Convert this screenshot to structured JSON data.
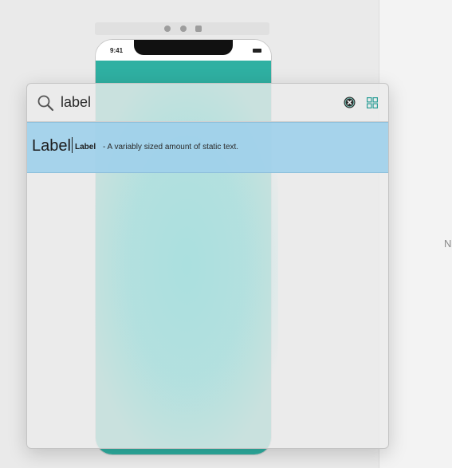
{
  "device": {
    "status_time": "9:41"
  },
  "inspector": {
    "partial_text": "N"
  },
  "library": {
    "search": {
      "value": "label",
      "clear_icon": "clear-circle-icon",
      "view_toggle_icon": "grid-icon"
    },
    "results": [
      {
        "preview_text": "Label",
        "title": "Label",
        "description": "- A variably sized amount of static text.",
        "selected": true
      }
    ]
  },
  "colors": {
    "device_content": "#2fb0a2",
    "selection": "#a0d0ea",
    "icon_teal": "#2a9d96"
  }
}
